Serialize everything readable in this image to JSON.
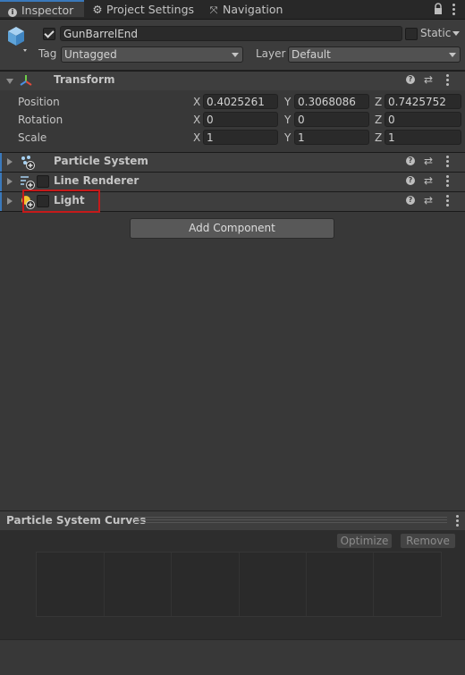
{
  "tabs": [
    {
      "label": "Inspector",
      "icon": "info-icon",
      "active": true
    },
    {
      "label": "Project Settings",
      "icon": "gear-icon",
      "active": false
    },
    {
      "label": "Navigation",
      "icon": "navigation-icon",
      "active": false
    }
  ],
  "gameobject": {
    "name": "GunBarrelEnd",
    "active": true,
    "static_label": "Static",
    "tag_label": "Tag",
    "tag_value": "Untagged",
    "layer_label": "Layer",
    "layer_value": "Default"
  },
  "transform": {
    "title": "Transform",
    "rows": [
      {
        "label": "Position",
        "x": "0.4025261",
        "y": "0.3068086",
        "z": "0.7425752"
      },
      {
        "label": "Rotation",
        "x": "0",
        "y": "0",
        "z": "0"
      },
      {
        "label": "Scale",
        "x": "1",
        "y": "1",
        "z": "1"
      }
    ],
    "axes": [
      "X",
      "Y",
      "Z"
    ]
  },
  "components": [
    {
      "title": "Particle System",
      "icon": "particle-system-icon",
      "has_checkbox": false
    },
    {
      "title": "Line Renderer",
      "icon": "line-renderer-icon",
      "has_checkbox": true
    },
    {
      "title": "Light",
      "icon": "light-icon",
      "has_checkbox": true
    }
  ],
  "add_component_label": "Add Component",
  "curves": {
    "title": "Particle System Curves",
    "optimize_label": "Optimize",
    "remove_label": "Remove"
  },
  "colors": {
    "accent": "#3a79bb",
    "highlight": "#c51a1a"
  }
}
